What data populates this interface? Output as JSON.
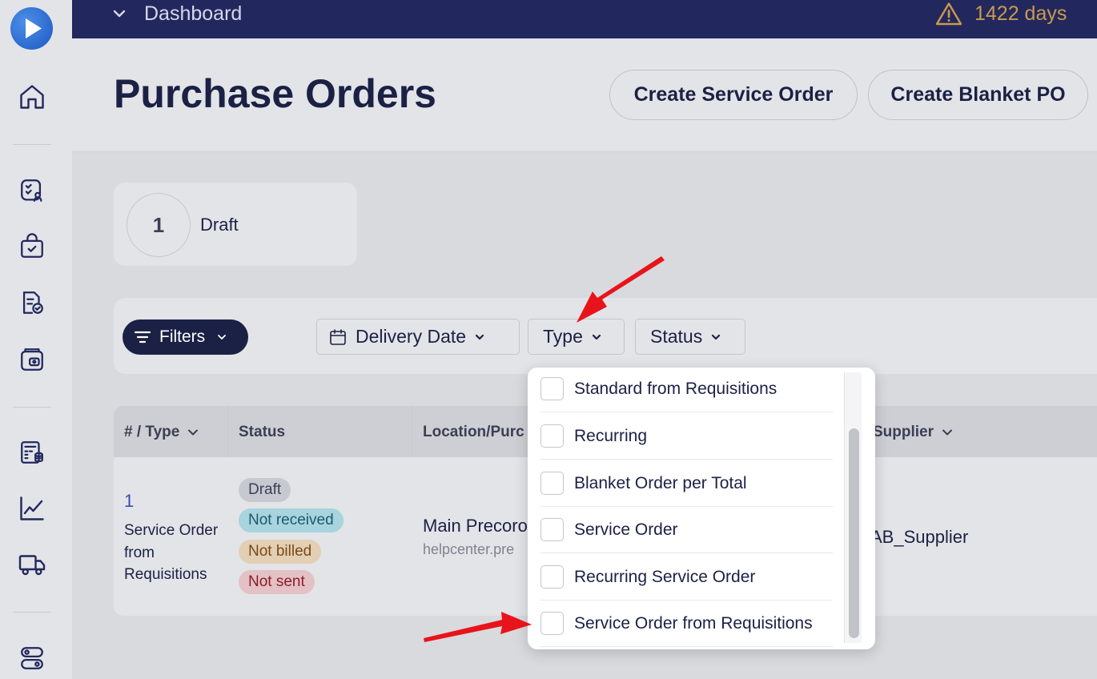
{
  "topbar": {
    "breadcrumb": "Dashboard",
    "trial_days": "1422 days"
  },
  "header": {
    "title": "Purchase Orders",
    "create_service_order": "Create Service Order",
    "create_blanket_po": "Create Blanket PO"
  },
  "summary": {
    "count": "1",
    "label": "Draft"
  },
  "filters": {
    "filters_button": "Filters",
    "delivery_date": "Delivery Date",
    "type": "Type",
    "status": "Status"
  },
  "table": {
    "headers": {
      "type": "# / Type",
      "status": "Status",
      "location": "Location/Purc",
      "supplier": "Supplier"
    },
    "rows": [
      {
        "number": "1",
        "type": "Service Order from Requisitions",
        "badges": [
          "Draft",
          "Not received",
          "Not billed",
          "Not sent"
        ],
        "location": "Main Precoro",
        "location_sub": "helpcenter.pre",
        "supplier": "AB_Supplier"
      }
    ]
  },
  "type_dropdown": {
    "options": [
      "Standard from Requisitions",
      "Recurring",
      "Blanket Order per Total",
      "Service Order",
      "Recurring Service Order",
      "Service Order from Requisitions"
    ]
  },
  "colors": {
    "topbar": "#22285e",
    "primary": "#1b2145",
    "link": "#3949b6",
    "warning": "#c99a4c",
    "annotation_arrow": "#e8141b"
  }
}
